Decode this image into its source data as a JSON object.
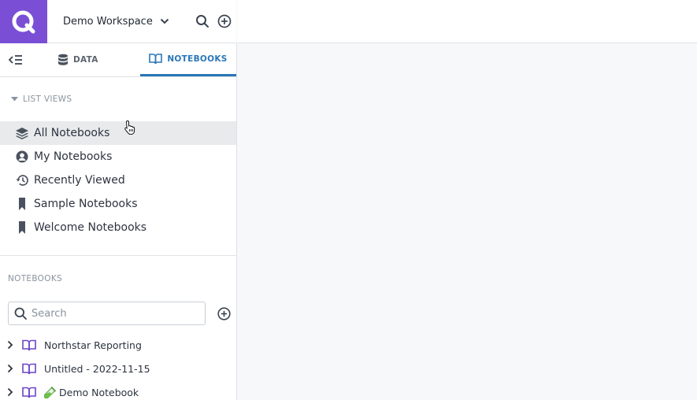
{
  "header": {
    "workspace_name": "Demo Workspace"
  },
  "tabs": [
    {
      "label": "DATA"
    },
    {
      "label": "NOTEBOOKS"
    }
  ],
  "list_views": {
    "heading": "LIST VIEWS",
    "items": [
      {
        "label": "All Notebooks",
        "icon": "layers-icon"
      },
      {
        "label": "My Notebooks",
        "icon": "user-icon"
      },
      {
        "label": "Recently Viewed",
        "icon": "history-icon"
      },
      {
        "label": "Sample Notebooks",
        "icon": "bookmark-icon"
      },
      {
        "label": "Welcome Notebooks",
        "icon": "bookmark-icon"
      }
    ]
  },
  "notebooks": {
    "heading": "NOTEBOOKS",
    "search_placeholder": "Search",
    "items": [
      {
        "label": "Northstar Reporting"
      },
      {
        "label": "Untitled - 2022-11-15"
      },
      {
        "label": "Demo Notebook"
      }
    ]
  },
  "colors": {
    "brand": "#7a4fd6",
    "accent": "#2a76b8",
    "book_icon": "#6a45c9"
  }
}
